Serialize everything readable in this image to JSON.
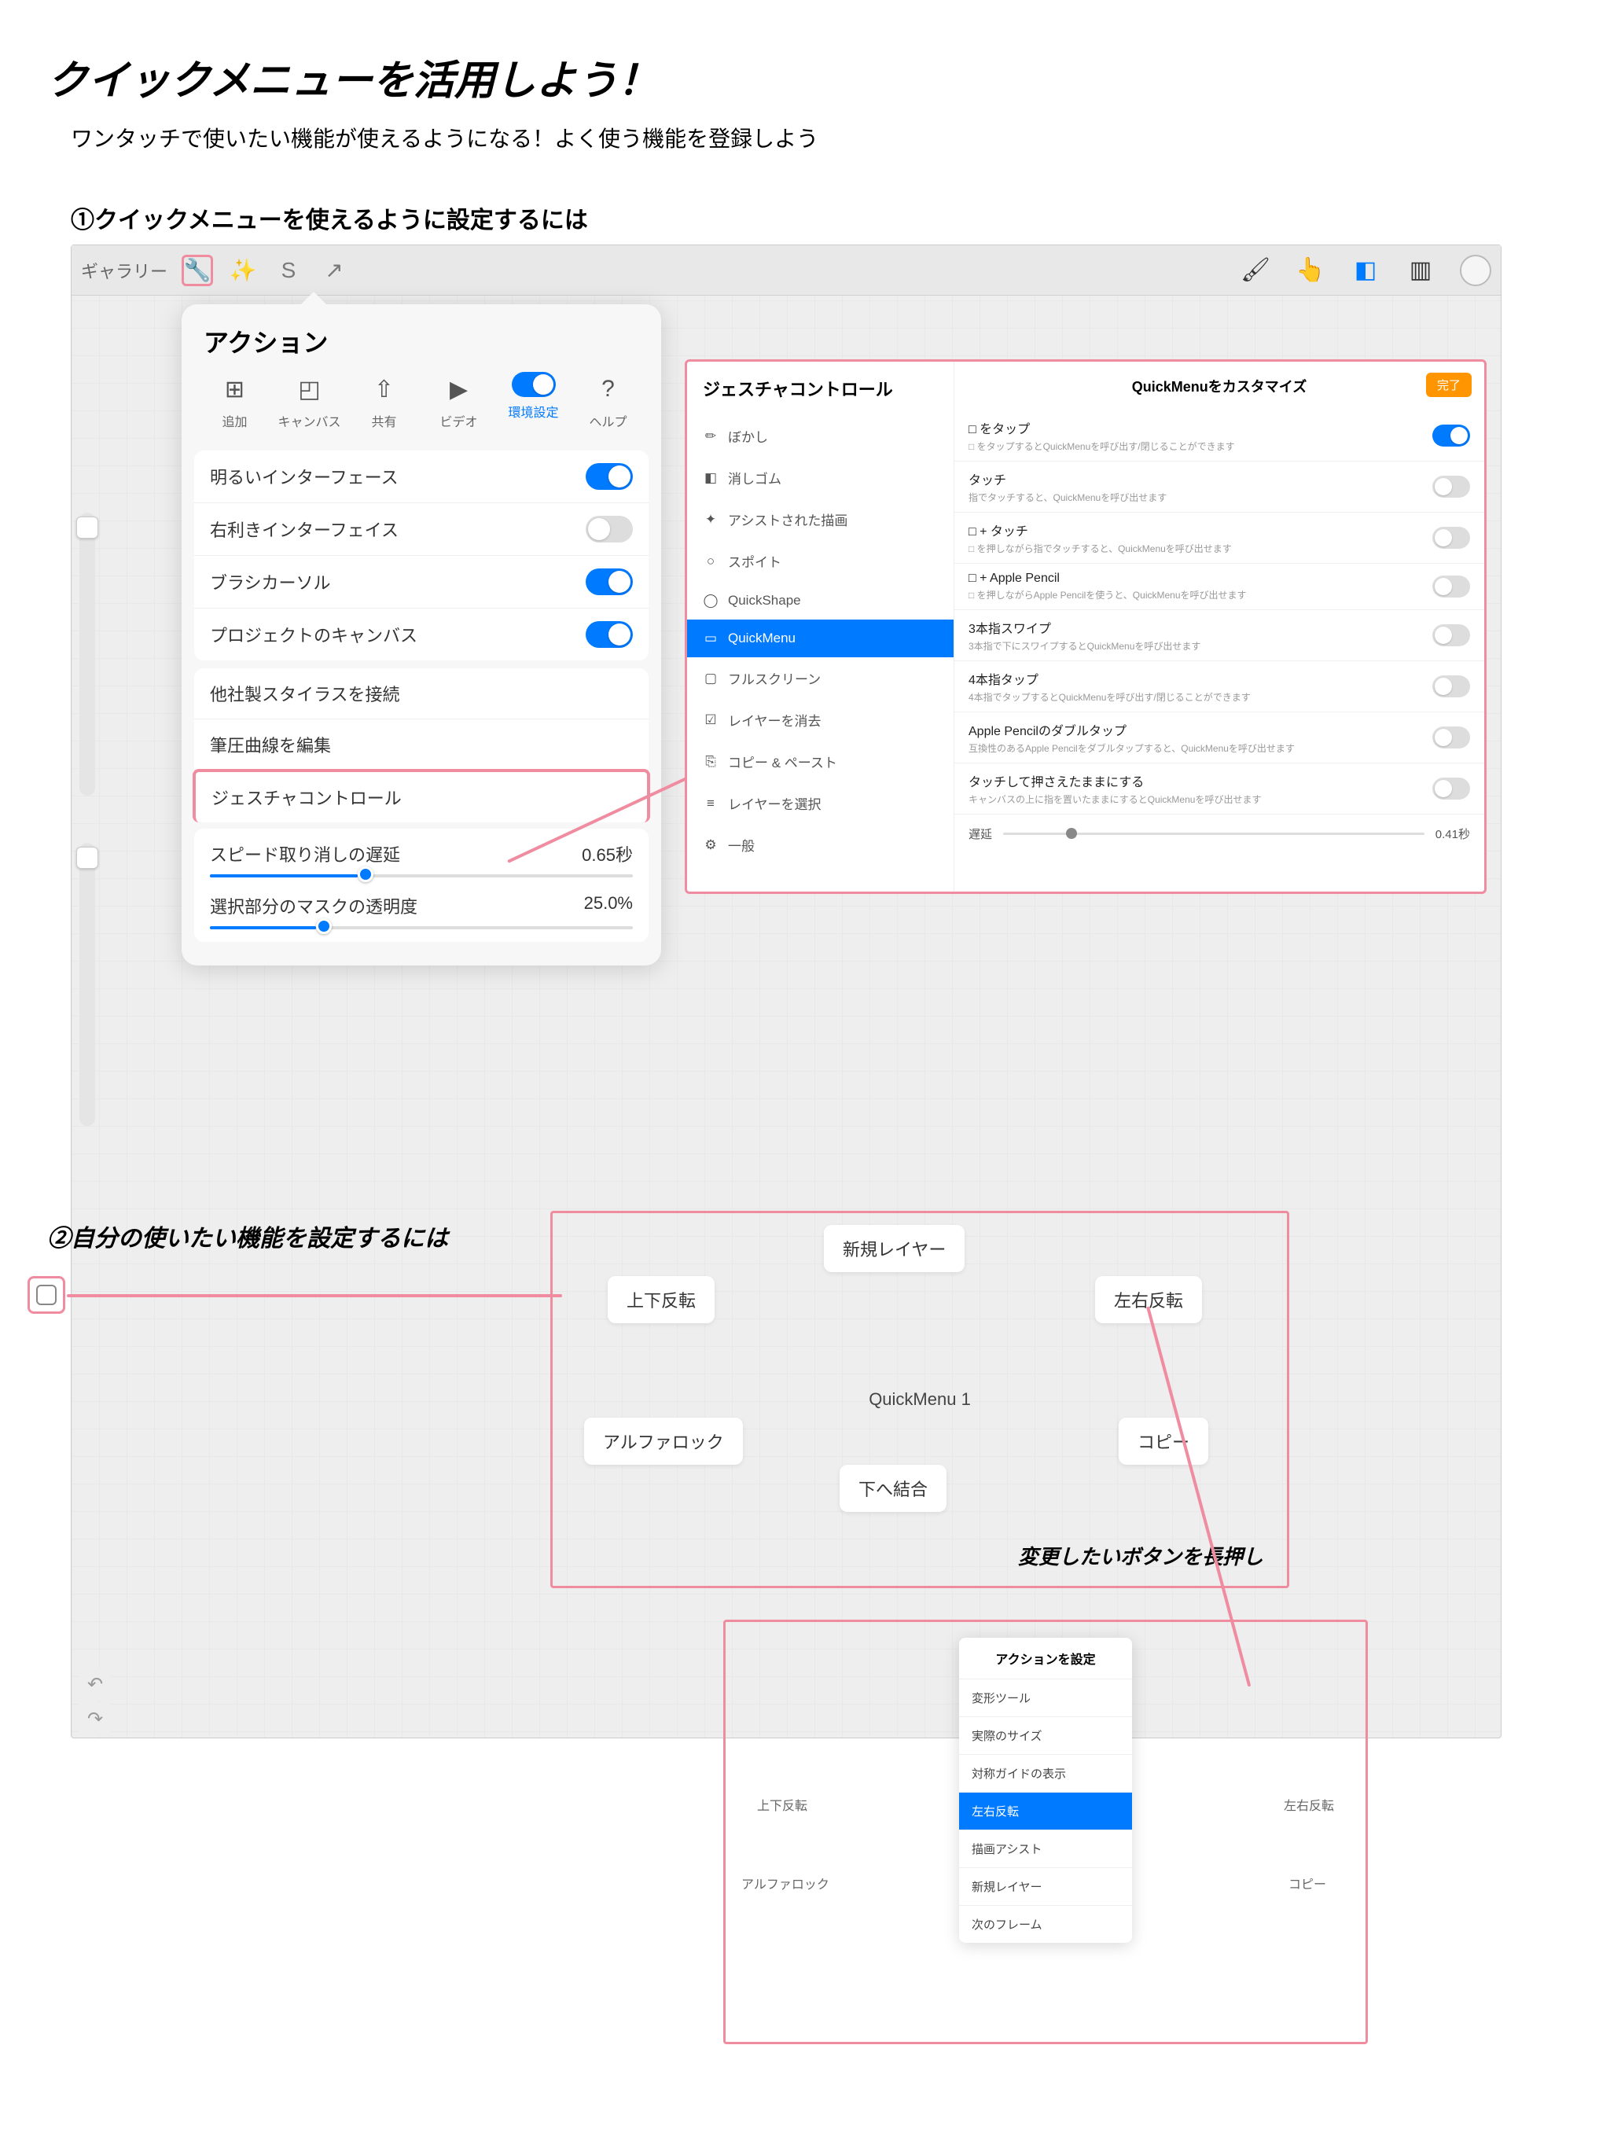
{
  "title": "クイックメニューを活用しよう！",
  "subtitle": "ワンタッチで使いたい機能が使えるようになる！よく使う機能を登録しよう",
  "section1": "①クイックメニューを使えるように設定するには",
  "section2": "②自分の使いたい機能を設定するには",
  "topbar": {
    "gallery": "ギャラリー"
  },
  "popover": {
    "title": "アクション",
    "tabs": {
      "add": "追加",
      "canvas": "キャンバス",
      "share": "共有",
      "video": "ビデオ",
      "prefs": "環境設定",
      "help": "ヘルプ"
    },
    "toggles": {
      "light": "明るいインターフェース",
      "right": "右利きインターフェイス",
      "brush": "ブラシカーソル",
      "project": "プロジェクトのキャンバス"
    },
    "list": {
      "stylus": "他社製スタイラスを接続",
      "pressure": "筆圧曲線を編集",
      "gesture": "ジェスチャコントロール"
    },
    "speed": {
      "label": "スピード取り消しの遅延",
      "value": "0.65秒"
    },
    "mask": {
      "label": "選択部分のマスクの透明度",
      "value": "25.0%"
    }
  },
  "gesture": {
    "title": "ジェスチャコントロール",
    "items": {
      "blur": "ぼかし",
      "eraser": "消しゴム",
      "assist": "アシストされた描画",
      "eyedrop": "スポイト",
      "qs": "QuickShape",
      "qm": "QuickMenu",
      "full": "フルスクリーン",
      "clear": "レイヤーを消去",
      "copy": "コピー & ペースト",
      "select": "レイヤーを選択",
      "general": "一般"
    },
    "rightTitle": "QuickMenuをカスタマイズ",
    "done": "完了",
    "rows": {
      "tap": {
        "t": "□ をタップ",
        "s": "□ をタップするとQuickMenuを呼び出す/閉じることができます"
      },
      "touch": {
        "t": "タッチ",
        "s": "指でタッチすると、QuickMenuを呼び出せます"
      },
      "sqtouch": {
        "t": "□ + タッチ",
        "s": "□ を押しながら指でタッチすると、QuickMenuを呼び出せます"
      },
      "pencil": {
        "t": "□ + Apple Pencil",
        "s": "□ を押しながらApple Pencilを使うと、QuickMenuを呼び出せます"
      },
      "swipe3": {
        "t": "3本指スワイプ",
        "s": "3本指で下にスワイプするとQuickMenuを呼び出せます"
      },
      "tap4": {
        "t": "4本指タップ",
        "s": "4本指でタップするとQuickMenuを呼び出す/閉じることができます"
      },
      "dtap": {
        "t": "Apple Pencilのダブルタップ",
        "s": "互換性のあるApple Pencilをダブルタップすると、QuickMenuを呼び出せます"
      },
      "hold": {
        "t": "タッチして押さえたままにする",
        "s": "キャンバスの上に指を置いたままにするとQuickMenuを呼び出せます"
      }
    },
    "delay": {
      "label": "遅延",
      "value": "0.41秒"
    }
  },
  "quickmenu": {
    "name": "QuickMenu 1",
    "flipv": "上下反転",
    "fliph": "左右反転",
    "newlayer": "新規レイヤー",
    "alpha": "アルファロック",
    "merge": "下へ結合",
    "copy": "コピー",
    "note": "変更したいボタンを長押し"
  },
  "actionlist": {
    "title": "アクションを設定",
    "items": {
      "transform": "変形ツール",
      "actual": "実際のサイズ",
      "guide": "対称ガイドの表示",
      "fliph": "左右反転",
      "assist": "描画アシスト",
      "newlayer": "新規レイヤー",
      "next": "次のフレーム"
    },
    "flipv": "上下反転",
    "fliphlbl": "左右反転",
    "alpha": "アルファロック",
    "copylbl": "コピー"
  }
}
